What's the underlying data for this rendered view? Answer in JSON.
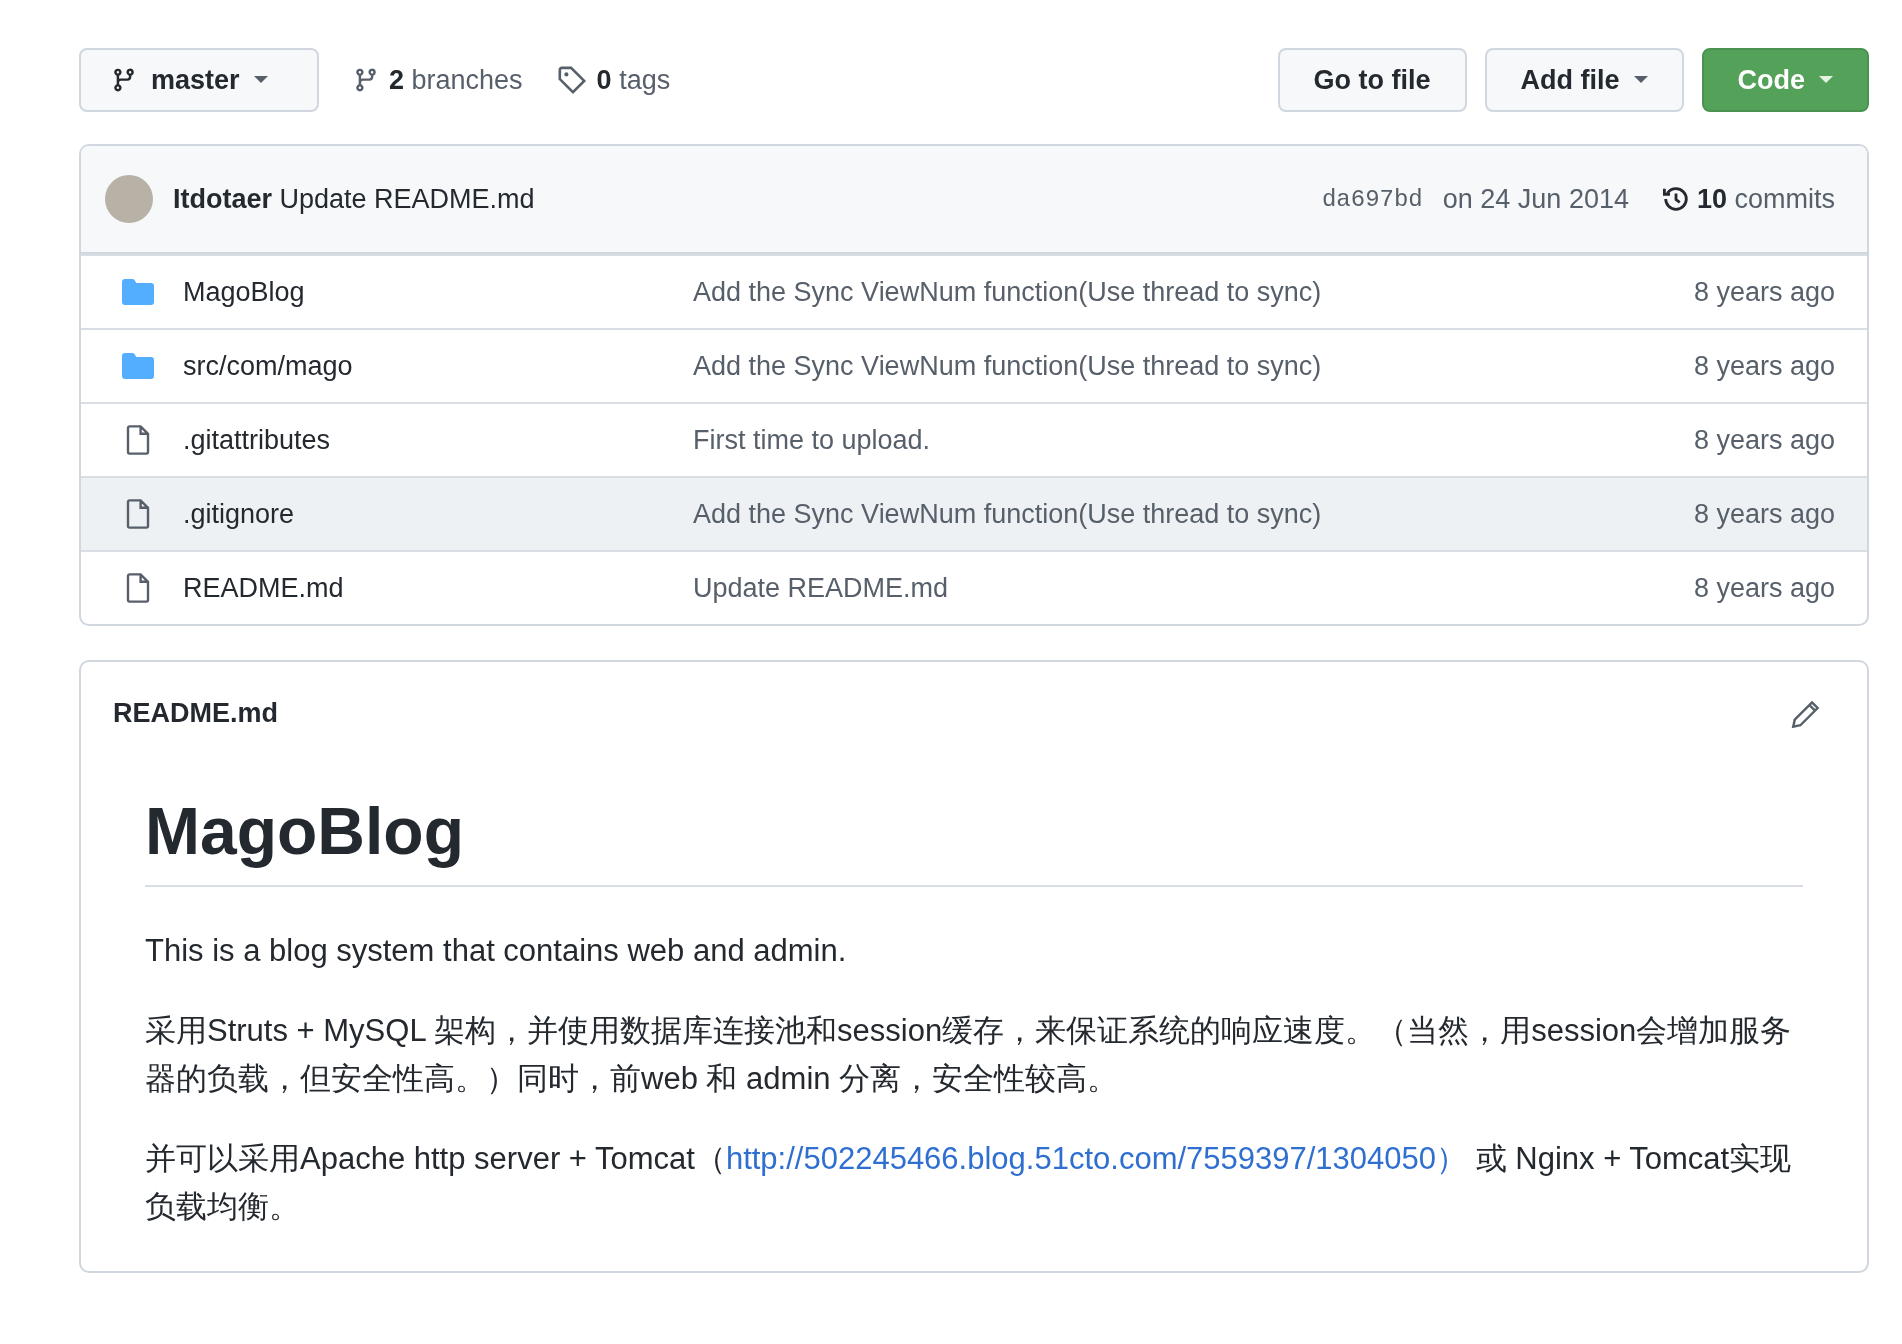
{
  "toolbar": {
    "branch": "master",
    "branches": "**2** branches",
    "tags": "**0** tags",
    "buttons": [
      {
        "label": "Go to file",
        "kind": "plain",
        "caret": false
      },
      {
        "label": "Add file",
        "kind": "plain",
        "caret": true
      },
      {
        "label": "Code",
        "kind": "primary",
        "caret": true
      }
    ]
  },
  "commit": {
    "message": "**Itdotaer** Update README.md",
    "sha": "da697bd",
    "date": "on 24 Jun 2014",
    "commits": "**10** commits"
  },
  "files": [
    {
      "kind": "folder",
      "name": "MagoBlog",
      "message": "Add the Sync ViewNum function(Use thread to sync)",
      "age": "8 years ago",
      "highlighted": false
    },
    {
      "kind": "folder",
      "name": "src/com/mago",
      "message": "Add the Sync ViewNum function(Use thread to sync)",
      "age": "8 years ago",
      "highlighted": false
    },
    {
      "kind": "file",
      "name": ".gitattributes",
      "message": "First time to upload.",
      "age": "8 years ago",
      "highlighted": false
    },
    {
      "kind": "file",
      "name": ".gitignore",
      "message": "Add the Sync ViewNum function(Use thread to sync)",
      "age": "8 years ago",
      "highlighted": true
    },
    {
      "kind": "file",
      "name": "README.md",
      "message": "Update README.md",
      "age": "8 years ago",
      "highlighted": false
    }
  ],
  "readme": {
    "filename": "README.md",
    "heading": "MagoBlog",
    "paragraphs": [
      {
        "text": "This is a blog system that contains web and admin."
      },
      {
        "text": "采用Struts + MySQL 架构，并使用数据库连接池和session缓存，来保证系统的响应速度。（当然，用session会增加服务器的负载，但安全性高。）同时，前web 和 admin 分离，安全性较高。"
      },
      {
        "text": "并可以采用Apache http server + Tomcat（",
        "link": "http://502245466.blog.51cto.com/7559397/1304050）",
        "after": " 或 Nginx + Tomcat实现负载均衡。"
      }
    ]
  }
}
